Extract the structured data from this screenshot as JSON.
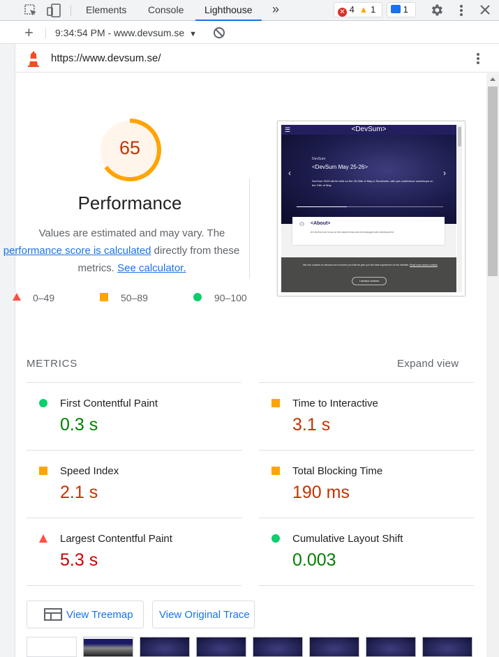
{
  "devtools": {
    "tabs": [
      "Elements",
      "Console",
      "Lighthouse"
    ],
    "more": "»",
    "errors": "4",
    "warnings": "1",
    "messages": "1"
  },
  "report_list": {
    "add": "+",
    "selected": "9:34:54 PM - www.devsum.se"
  },
  "url": "https://www.devsum.se/",
  "score": {
    "value": "65",
    "value_fraction": 0.65,
    "title": "Performance",
    "desc_1": "Values are estimated and may vary. The",
    "desc_link_1": "performance score is calculated",
    "desc_2": " directly from these",
    "desc_3": "metrics. ",
    "desc_link_2": "See calculator."
  },
  "legend": [
    {
      "range": "0–49"
    },
    {
      "range": "50–89"
    },
    {
      "range": "90–100"
    }
  ],
  "screenshot": {
    "logo": "<DevSum>",
    "eyebrow": "DevSum",
    "event_title": "<DevSum May 25-26>",
    "event_desc": "DevSum 2023 will be held on the 25-26th of May in Stockholm, with pre-conference workshops on the 24th of May.",
    "about_title": "<About>",
    "about_text": "At DevSum we focus on the latest trends and technologies with development.",
    "cookie_text": "We use cookies on devsum.se to ensure you that we give you the best experience on the website.",
    "cookie_link": "Read more about cookies",
    "cookie_button": "I accept cookies"
  },
  "metrics": {
    "header": "METRICS",
    "expand": "Expand view",
    "items": [
      {
        "label": "First Contentful Paint",
        "value": "0.3 s",
        "status": "pass"
      },
      {
        "label": "Time to Interactive",
        "value": "3.1 s",
        "status": "average"
      },
      {
        "label": "Speed Index",
        "value": "2.1 s",
        "status": "average"
      },
      {
        "label": "Total Blocking Time",
        "value": "190 ms",
        "status": "average"
      },
      {
        "label": "Largest Contentful Paint",
        "value": "5.3 s",
        "status": "fail"
      },
      {
        "label": "Cumulative Layout Shift",
        "value": "0.003",
        "status": "pass"
      }
    ]
  },
  "buttons": {
    "treemap": "View Treemap",
    "trace": "View Original Trace"
  },
  "colors": {
    "pass": "#0cce6b",
    "pass_text": "#008000",
    "average": "#ffa400",
    "average_text": "#c33300",
    "fail": "#ff4e42",
    "fail_text": "#cc0000",
    "link": "#1a73e8"
  }
}
